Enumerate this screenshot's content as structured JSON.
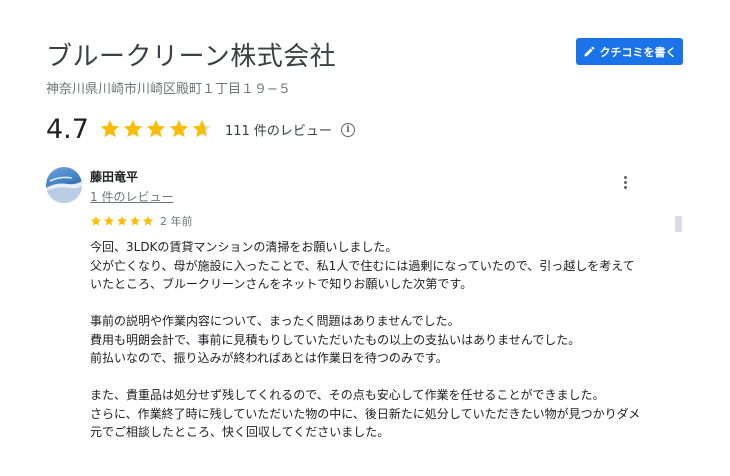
{
  "business": {
    "name": "ブルークリーン株式会社",
    "address": "神奈川県川崎市川崎区殿町１丁目１９−５",
    "write_review_label": "クチコミを書く",
    "rating": "4.7",
    "rating_stars": 4.7,
    "review_count": "111 件のレビュー",
    "info_icon": "ⓘ"
  },
  "review": {
    "reviewer_name": "藤田竜平",
    "reviewer_review_count": "1 件のレビュー",
    "stars": 5,
    "date": "2 年前",
    "lines": [
      "今回、3LDKの賃貸マンションの清掃をお願いしました。",
      "父が亡くなり、母が施設に入ったことで、私1人で住むには過剰になっていたので、引っ越しを考えて",
      "いたところ、ブルークリーンさんをネットで知りお願いした次第です。",
      "",
      "事前の説明や作業内容について、まったく問題はありませんでした。",
      "費用も明朗会計で、事前に見積もりしていただいたもの以上の支払いはありませんでした。",
      "前払いなので、振り込みが終わればあとは作業日を待つのみです。",
      "",
      "また、貴重品は処分せず残してくれるので、その点も安心して作業を任せることができました。",
      "さらに、作業終了時に残していただいた物の中に、後日新たに処分していただきたい物が見つかりダメ",
      "元でご相談したところ、快く回収してくださいました。"
    ]
  },
  "colors": {
    "star": "#fbbc04",
    "star_empty": "#dadce0",
    "accent": "#1a73e8",
    "muted": "#70757a"
  },
  "icons": {
    "write": "pencil-icon",
    "info": "info-icon",
    "more": "more-vert-icon"
  }
}
